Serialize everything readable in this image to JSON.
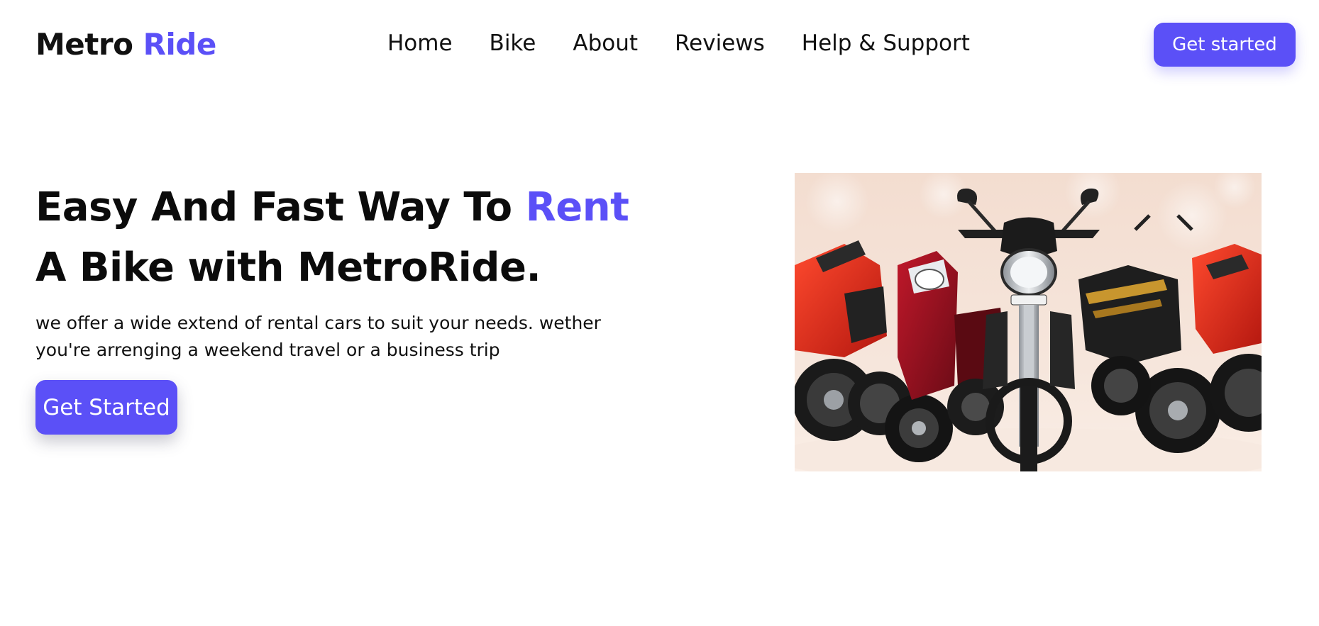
{
  "header": {
    "logo_main": "Metro",
    "logo_accent": "Ride",
    "nav": [
      {
        "label": "Home"
      },
      {
        "label": "Bike"
      },
      {
        "label": "About"
      },
      {
        "label": "Reviews"
      },
      {
        "label": "Help & Support"
      }
    ],
    "cta_label": "Get started"
  },
  "hero": {
    "title_part1": "Easy And Fast Way To ",
    "title_accent": "Rent",
    "title_line2": "A Bike with MetroRide.",
    "description": "we offer a wide extend of rental cars to suit your needs. wether you're arrenging a weekend travel or a business trip",
    "cta_label": "Get Started",
    "image_alt": "Lineup of motorcycles and scooters"
  },
  "colors": {
    "accent": "#5b50f7",
    "text": "#111111",
    "background": "#ffffff"
  }
}
